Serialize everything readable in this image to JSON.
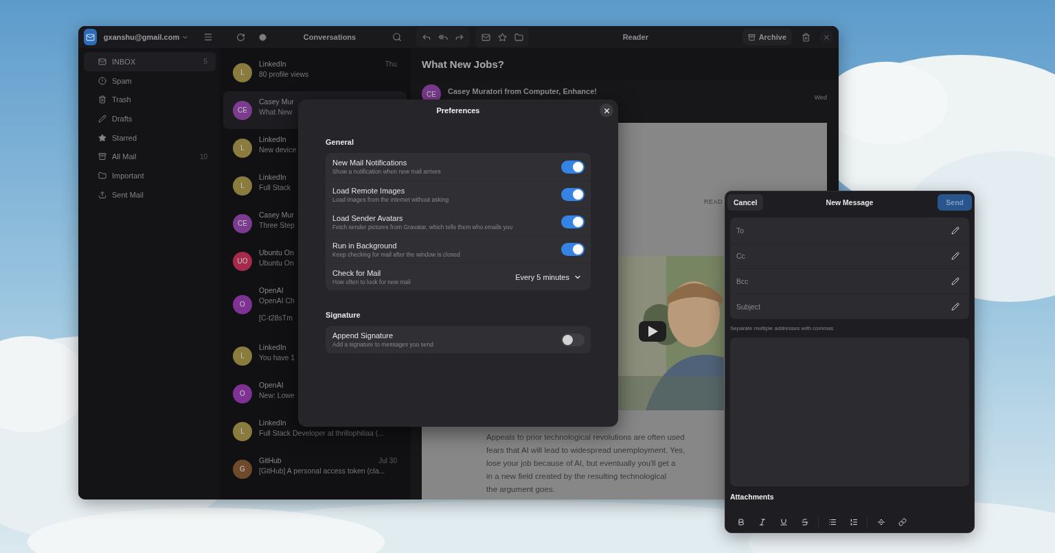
{
  "account": {
    "email": "gxanshu@gmail.com"
  },
  "sidebar": {
    "items": [
      {
        "kind": "inbox",
        "label": "INBOX",
        "count": "5",
        "selected": true
      },
      {
        "kind": "spam",
        "label": "Spam",
        "selected": false
      },
      {
        "kind": "trash",
        "label": "Trash",
        "selected": false
      },
      {
        "kind": "drafts",
        "label": "Drafts",
        "selected": false
      },
      {
        "kind": "starred",
        "label": "Starred",
        "selected": false
      },
      {
        "kind": "all",
        "label": "All Mail",
        "count": "10",
        "selected": false
      },
      {
        "kind": "important",
        "label": "Important",
        "selected": false
      },
      {
        "kind": "sent",
        "label": "Sent Mail",
        "selected": false
      }
    ]
  },
  "conversations": {
    "title": "Conversations",
    "items": [
      {
        "initials": "L",
        "color": "#8a7b3e",
        "sender": "LinkedIn",
        "preview": "80 profile views",
        "date": "Thu",
        "selected": false
      },
      {
        "initials": "CE",
        "color": "#7b3b8e",
        "sender": "Casey Mur",
        "preview": "What New",
        "selected": true
      },
      {
        "initials": "L",
        "color": "#8a7b3e",
        "sender": "LinkedIn",
        "preview": "New device",
        "selected": false
      },
      {
        "initials": "L",
        "color": "#8a7b3e",
        "sender": "LinkedIn",
        "preview": "Full Stack",
        "selected": false
      },
      {
        "initials": "CE",
        "color": "#7b3b8e",
        "sender": "Casey Mur",
        "preview": "Three Step",
        "selected": false
      },
      {
        "initials": "UO",
        "color": "#a52a4c",
        "sender": "Ubuntu On",
        "preview": "Ubuntu On",
        "selected": false
      },
      {
        "initials": "O",
        "color": "#7e3394",
        "sender": "OpenAI",
        "preview": "OpenAI Ch",
        "extra": "[C-t28sTm",
        "selected": false
      },
      {
        "initials": "L",
        "color": "#8a7b3e",
        "sender": "LinkedIn",
        "preview": "You have 1",
        "selected": false
      },
      {
        "initials": "O",
        "color": "#7e3394",
        "sender": "OpenAI",
        "preview": "New: Lowe",
        "selected": false
      },
      {
        "initials": "L",
        "color": "#8a7b3e",
        "sender": "LinkedIn",
        "preview": "Full Stack Developer at thrillophiliaa  (...",
        "selected": false
      },
      {
        "initials": "G",
        "color": "#6e4a2a",
        "sender": "GitHub",
        "preview": "[GitHub] A personal access token (cla...",
        "date": "Jul 30",
        "selected": false
      }
    ]
  },
  "reader": {
    "title": "Reader",
    "archive": "Archive",
    "subject": "What New Jobs?",
    "sender": "Casey Muratori from Computer, Enhance!",
    "initials": "CE",
    "color": "#7b3b8e",
    "date": "Wed",
    "read_label": "READ",
    "body_lines": [
      "Appeals to prior technological revolutions are often used",
      "fears that AI will lead to widespread unemployment. Yes,",
      "lose your job because of AI, but eventually you'll get a",
      "in a new field created by the resulting technological",
      "the argument goes."
    ]
  },
  "preferences": {
    "title": "Preferences",
    "sections": [
      {
        "title": "General",
        "rows": [
          {
            "kind": "toggle",
            "label": "New Mail Notifications",
            "description": "Show a notification when new mail arrives",
            "on": true
          },
          {
            "kind": "toggle",
            "label": "Load Remote Images",
            "description": "Load images from the internet without asking",
            "on": true
          },
          {
            "kind": "toggle",
            "label": "Load Sender Avatars",
            "description": "Fetch sender pictures from Gravatar, which tells them who emails you",
            "on": true
          },
          {
            "kind": "toggle",
            "label": "Run in Background",
            "description": "Keep checking for mail after the window is closed",
            "on": true
          },
          {
            "kind": "select",
            "label": "Check for Mail",
            "description": "How often to look for new mail",
            "value": "Every 5 minutes"
          }
        ]
      },
      {
        "title": "Signature",
        "rows": [
          {
            "kind": "toggle",
            "label": "Append Signature",
            "description": "Add a signature to messages you send",
            "on": false
          }
        ]
      }
    ]
  },
  "compose": {
    "title": "New Message",
    "cancel": "Cancel",
    "send": {
      "label": "Send",
      "disabled": true
    },
    "fields": [
      {
        "placeholder": "To"
      },
      {
        "placeholder": "Cc"
      },
      {
        "placeholder": "Bcc"
      },
      {
        "placeholder": "Subject"
      }
    ],
    "hint": "Separate multiple addresses with commas",
    "attachments": "Attachments"
  }
}
